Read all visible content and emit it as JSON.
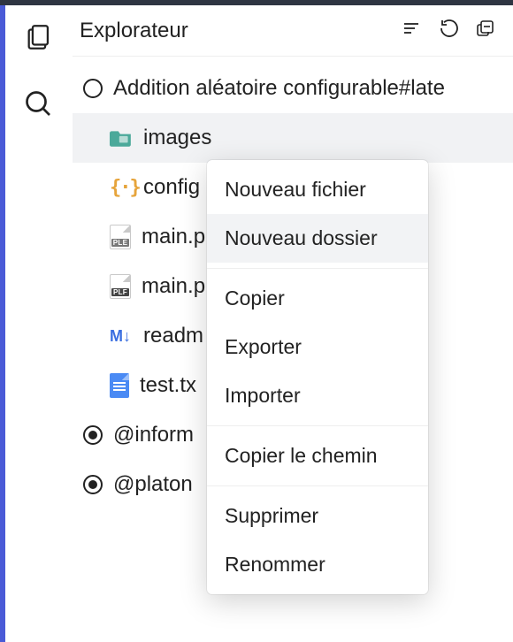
{
  "header": {
    "title": "Explorateur"
  },
  "tree": {
    "root": {
      "label": "Addition aléatoire configurable#late"
    },
    "folder": {
      "label": "images"
    },
    "files": [
      {
        "label": "config"
      },
      {
        "label": "main.p",
        "badge": "PLE"
      },
      {
        "label": "main.p",
        "badge": "PLF"
      },
      {
        "label": "readm"
      },
      {
        "label": "test.tx"
      }
    ],
    "refs": [
      {
        "label": "@inform"
      },
      {
        "label": "@platon"
      }
    ]
  },
  "context_menu": {
    "items": [
      {
        "label": "Nouveau fichier"
      },
      {
        "label": "Nouveau dossier",
        "hover": true
      },
      {
        "sep": true
      },
      {
        "label": "Copier"
      },
      {
        "label": "Exporter"
      },
      {
        "label": "Importer"
      },
      {
        "sep": true
      },
      {
        "label": "Copier le chemin"
      },
      {
        "sep": true
      },
      {
        "label": "Supprimer"
      },
      {
        "label": "Renommer"
      }
    ]
  }
}
